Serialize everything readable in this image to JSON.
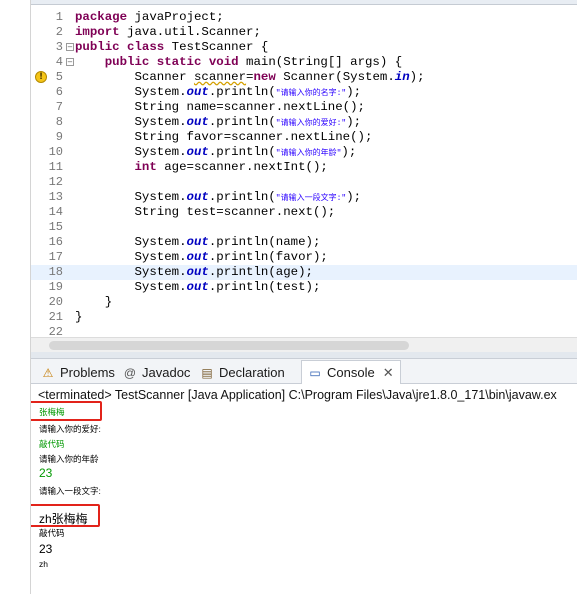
{
  "editor": {
    "lines": [
      {
        "n": "1",
        "tokens": [
          {
            "t": "package",
            "c": "kw"
          },
          {
            "t": " javaProject;"
          }
        ]
      },
      {
        "n": "2",
        "tokens": [
          {
            "t": "import",
            "c": "kw"
          },
          {
            "t": " java.util.Scanner;"
          }
        ]
      },
      {
        "n": "3",
        "tokens": [
          {
            "t": "public class",
            "c": "kw"
          },
          {
            "t": " TestScanner {"
          }
        ]
      },
      {
        "n": "4",
        "tokens": [
          {
            "t": "    "
          },
          {
            "t": "public static void",
            "c": "kw"
          },
          {
            "t": " main(String[] args) {"
          }
        ]
      },
      {
        "n": "5",
        "tokens": [
          {
            "t": "        Scanner "
          },
          {
            "t": "scanner",
            "c": "warn-u"
          },
          {
            "t": "="
          },
          {
            "t": "new",
            "c": "kw"
          },
          {
            "t": " Scanner(System."
          },
          {
            "t": "in",
            "c": "fld"
          },
          {
            "t": ");"
          }
        ]
      },
      {
        "n": "6",
        "tokens": [
          {
            "t": "        System."
          },
          {
            "t": "out",
            "c": "fld"
          },
          {
            "t": ".println("
          },
          {
            "t": "\"请输入你的名字:\"",
            "c": "st cjk"
          },
          {
            "t": ");"
          }
        ]
      },
      {
        "n": "7",
        "tokens": [
          {
            "t": "        String name=scanner.nextLine();"
          }
        ]
      },
      {
        "n": "8",
        "tokens": [
          {
            "t": "        System."
          },
          {
            "t": "out",
            "c": "fld"
          },
          {
            "t": ".println("
          },
          {
            "t": "\"请输入你的爱好:\"",
            "c": "st cjk"
          },
          {
            "t": ");"
          }
        ]
      },
      {
        "n": "9",
        "tokens": [
          {
            "t": "        String favor=scanner.nextLine();"
          }
        ]
      },
      {
        "n": "10",
        "tokens": [
          {
            "t": "        System."
          },
          {
            "t": "out",
            "c": "fld"
          },
          {
            "t": ".println("
          },
          {
            "t": "\"请输入你的年龄\"",
            "c": "st cjk"
          },
          {
            "t": ");"
          }
        ]
      },
      {
        "n": "11",
        "tokens": [
          {
            "t": "        "
          },
          {
            "t": "int",
            "c": "kw"
          },
          {
            "t": " age=scanner.nextInt();"
          }
        ]
      },
      {
        "n": "12",
        "tokens": [
          {
            "t": ""
          }
        ]
      },
      {
        "n": "13",
        "tokens": [
          {
            "t": "        System."
          },
          {
            "t": "out",
            "c": "fld"
          },
          {
            "t": ".println("
          },
          {
            "t": "\"请输入一段文字:\"",
            "c": "st cjk"
          },
          {
            "t": ");"
          }
        ]
      },
      {
        "n": "14",
        "tokens": [
          {
            "t": "        String test=scanner.next();"
          }
        ]
      },
      {
        "n": "15",
        "tokens": [
          {
            "t": ""
          }
        ]
      },
      {
        "n": "16",
        "tokens": [
          {
            "t": "        System."
          },
          {
            "t": "out",
            "c": "fld"
          },
          {
            "t": ".println(name);"
          }
        ]
      },
      {
        "n": "17",
        "tokens": [
          {
            "t": "        System."
          },
          {
            "t": "out",
            "c": "fld"
          },
          {
            "t": ".println(favor);"
          }
        ]
      },
      {
        "n": "18",
        "tokens": [
          {
            "t": "        System."
          },
          {
            "t": "out",
            "c": "fld"
          },
          {
            "t": ".println(age);"
          }
        ]
      },
      {
        "n": "19",
        "tokens": [
          {
            "t": "        System."
          },
          {
            "t": "out",
            "c": "fld"
          },
          {
            "t": ".println(test);"
          }
        ]
      },
      {
        "n": "20",
        "tokens": [
          {
            "t": "    }"
          }
        ]
      },
      {
        "n": "21",
        "tokens": [
          {
            "t": "}"
          }
        ]
      },
      {
        "n": "22",
        "tokens": [
          {
            "t": ""
          }
        ]
      }
    ],
    "current_line": "18",
    "warning_line": "5",
    "fold_lines": [
      "3",
      "4"
    ]
  },
  "views": {
    "tabs": [
      {
        "label": "Problems",
        "icon": "problems-icon",
        "glyph": "⚠"
      },
      {
        "label": "Javadoc",
        "icon": "javadoc-icon",
        "glyph": "@"
      },
      {
        "label": "Declaration",
        "icon": "declaration-icon",
        "glyph": "▤"
      },
      {
        "label": "Console",
        "icon": "console-icon",
        "glyph": "▭"
      }
    ],
    "active_tab": "Console",
    "close_glyph": "✕"
  },
  "console": {
    "status": "<terminated> TestScanner [Java Application] C:\\Program Files\\Java\\jre1.8.0_171\\bin\\javaw.ex",
    "lines": [
      {
        "text": "张梅梅",
        "kind": "inp"
      },
      {
        "text": "请输入你的爱好:",
        "kind": "out"
      },
      {
        "text": "敲代码",
        "kind": "inp"
      },
      {
        "text": "请输入你的年龄",
        "kind": "out"
      },
      {
        "text": "23",
        "kind": "inp num"
      },
      {
        "text": "请输入一段文字:",
        "kind": "out"
      },
      {
        "text": "zh张梅梅",
        "kind": "mixed"
      },
      {
        "text": "敲代码",
        "kind": "out"
      },
      {
        "text": "23",
        "kind": "out num"
      },
      {
        "text": "zh",
        "kind": "out"
      }
    ]
  },
  "colors": {
    "keyword": "#7f0055",
    "string": "#2a00ff",
    "field": "#0000c0",
    "console_input": "#009900",
    "highlight_box": "#e2231a"
  }
}
